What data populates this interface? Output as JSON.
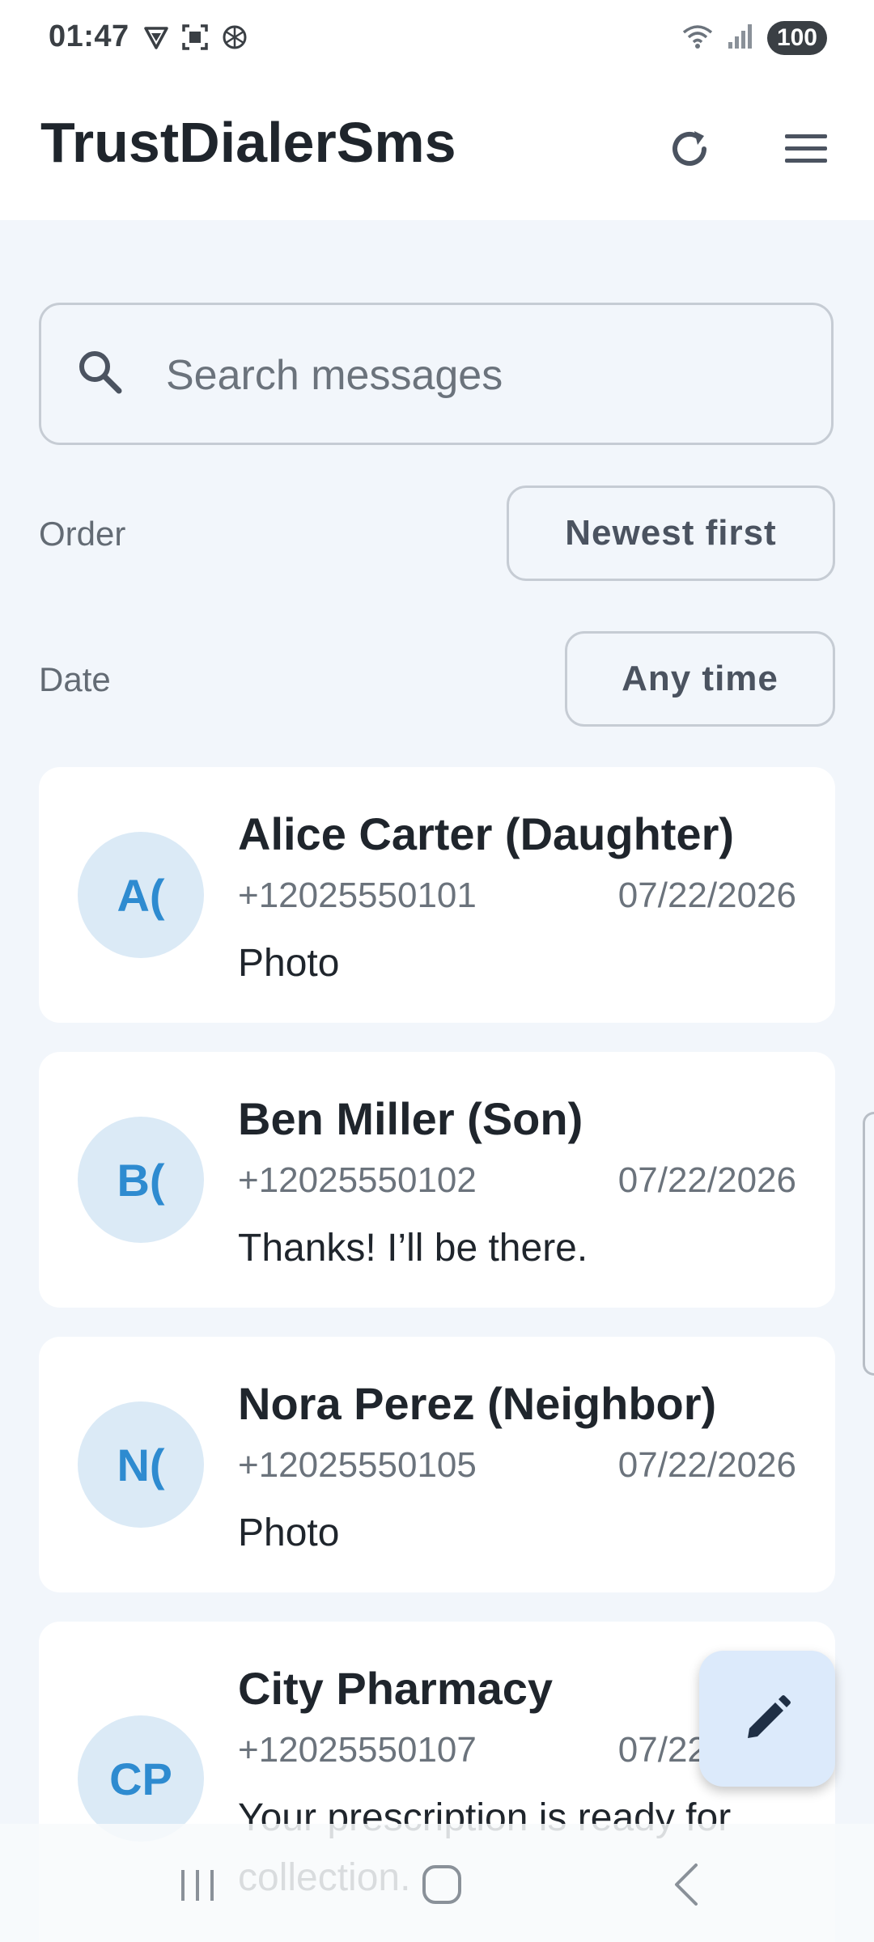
{
  "status_bar": {
    "time": "01:47",
    "battery": "100",
    "icons_left": [
      "vpn-shield-icon",
      "screenshot-icon",
      "chatgpt-icon"
    ],
    "icons_right": [
      "wifi-icon",
      "signal-icon"
    ]
  },
  "app_bar": {
    "title": "TrustDialerSms",
    "actions": [
      "refresh-icon",
      "hamburger-menu-icon"
    ]
  },
  "search": {
    "placeholder": "Search messages",
    "value": ""
  },
  "filters": {
    "order_label": "Order",
    "order_value": "Newest first",
    "date_label": "Date",
    "date_value": "Any time"
  },
  "messages": [
    {
      "initials": "A(",
      "name": "Alice Carter (Daughter)",
      "phone": "+12025550101",
      "date": "07/22/2026",
      "preview": "Photo"
    },
    {
      "initials": "B(",
      "name": "Ben Miller (Son)",
      "phone": "+12025550102",
      "date": "07/22/2026",
      "preview": "Thanks! I’ll be there."
    },
    {
      "initials": "N(",
      "name": "Nora Perez (Neighbor)",
      "phone": "+12025550105",
      "date": "07/22/2026",
      "preview": "Photo"
    },
    {
      "initials": "CP",
      "name": "City Pharmacy",
      "phone": "+12025550107",
      "date": "07/22/2026",
      "preview": "Your prescription is ready for collection."
    }
  ],
  "fab": {
    "icon": "pencil-icon"
  },
  "nav_bar": {
    "buttons": [
      "recents-icon",
      "home-icon",
      "back-icon"
    ]
  },
  "colors": {
    "background": "#f2f6fb",
    "surface": "#ffffff",
    "accent": "#2e8bd0",
    "avatar_bg": "#dbeaf6",
    "fab_bg": "#dceafb"
  }
}
